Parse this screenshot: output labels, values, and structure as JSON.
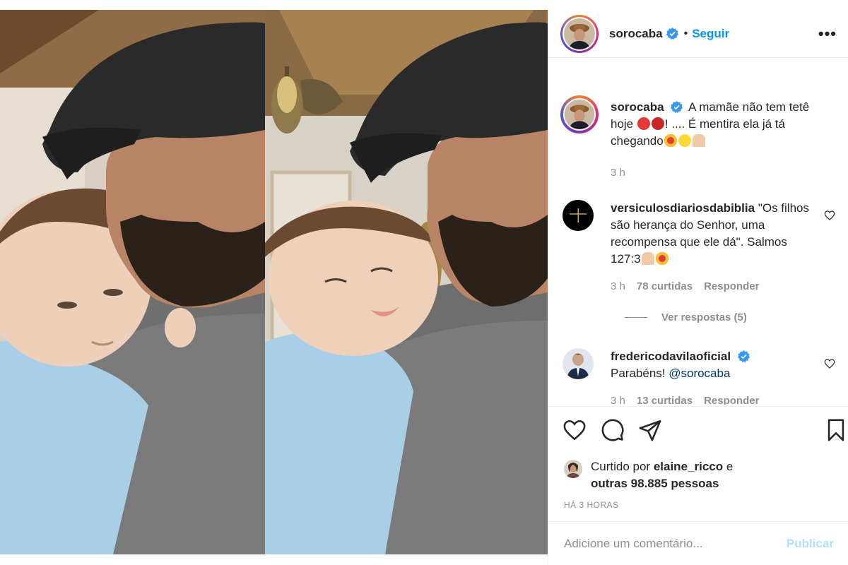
{
  "post": {
    "author": "soroca­ba",
    "follow_label": "Seguir",
    "dot": "•",
    "more_label": "•••"
  },
  "caption": {
    "user": "sorocaba",
    "text_part1": "A mamãe não tem tetê hoje ",
    "text_part2": "! .... É mentira ela já tá chegando",
    "time": "3 h"
  },
  "comments": [
    {
      "user": "versiculosdiariosdabiblia",
      "text": "\"Os filhos são herança do Senhor, uma recompensa que ele dá\". Salmos 127:3",
      "time": "3 h",
      "likes": "78 curtidas",
      "reply_label": "Responder",
      "view_replies": "Ver respostas (5)"
    },
    {
      "user": "fredericodavilaoficial",
      "text": "Parabéns! ",
      "mention": "@sorocaba",
      "time": "3 h",
      "likes": "13 curtidas",
      "reply_label": "Responder"
    }
  ],
  "likes": {
    "prefix": "Curtido por ",
    "user": "elaine_ricco",
    "mid": " e",
    "others": "outras 98.885 pessoas"
  },
  "timestamp": "HÁ 3 HORAS",
  "composer": {
    "placeholder": "Adicione um comentário...",
    "publish_label": "Publicar"
  },
  "icons": {
    "verified": "verified-badge-icon",
    "heart": "heart-icon",
    "comment": "comment-icon",
    "share": "paper-plane-icon",
    "save": "bookmark-icon"
  },
  "colors": {
    "link": "#0095f6",
    "muted": "#8e8e8e",
    "text": "#262626",
    "publish_disabled": "#b2dffc"
  }
}
